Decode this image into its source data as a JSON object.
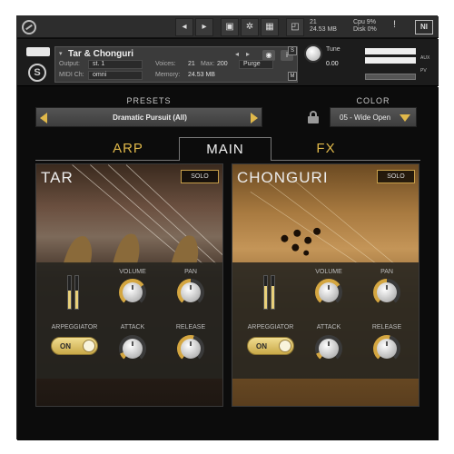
{
  "topbar": {
    "stat_voices": "21",
    "stat_memory": "24.53 MB",
    "cpu_label": "Cpu",
    "cpu_value": "9%",
    "disk_label": "Disk",
    "disk_value": "0%",
    "ni_label": "NI",
    "warn_label": "!"
  },
  "instrument": {
    "name": "Tar & Chonguri",
    "output_label": "Output:",
    "output_value": "st. 1",
    "midi_label": "MIDI Ch:",
    "midi_value": "omni",
    "voices_label": "Voices:",
    "voices_value": "21",
    "max_label": "Max:",
    "max_value": "200",
    "purge_label": "Purge",
    "memory_label": "Memory:",
    "memory_value": "24.53 MB",
    "tune_label": "Tune",
    "tune_value": "0.00",
    "s_label": "S",
    "m_label": "M",
    "aux_label": "AUX",
    "pv_label": "PV"
  },
  "presets": {
    "label": "PRESETS",
    "value": "Dramatic Pursuit (All)"
  },
  "color": {
    "label": "COLOR",
    "value": "05 - Wide Open"
  },
  "tabs": [
    {
      "label": "ARP"
    },
    {
      "label": "MAIN"
    },
    {
      "label": "FX"
    }
  ],
  "active_tab": "MAIN",
  "cards": [
    {
      "title": "TAR",
      "solo": "SOLO",
      "volume_label": "VOLUME",
      "pan_label": "PAN",
      "arp_label": "ARPEGGIATOR",
      "arp_state": "ON",
      "attack_label": "ATTACK",
      "release_label": "RELEASE",
      "volume_level": 0.7,
      "pan_level": 0.5,
      "attack_level": 0.1,
      "release_level": 0.55,
      "meter_left": 0.55,
      "meter_right": 0.55
    },
    {
      "title": "CHONGURI",
      "solo": "SOLO",
      "volume_label": "VOLUME",
      "pan_label": "PAN",
      "arp_label": "ARPEGGIATOR",
      "arp_state": "ON",
      "attack_label": "ATTACK",
      "release_label": "RELEASE",
      "volume_level": 0.7,
      "pan_level": 0.5,
      "attack_level": 0.1,
      "release_level": 0.55,
      "meter_left": 0.7,
      "meter_right": 0.7
    }
  ],
  "colors": {
    "accent": "#e0b84a",
    "panel": "#0c0c0c"
  }
}
